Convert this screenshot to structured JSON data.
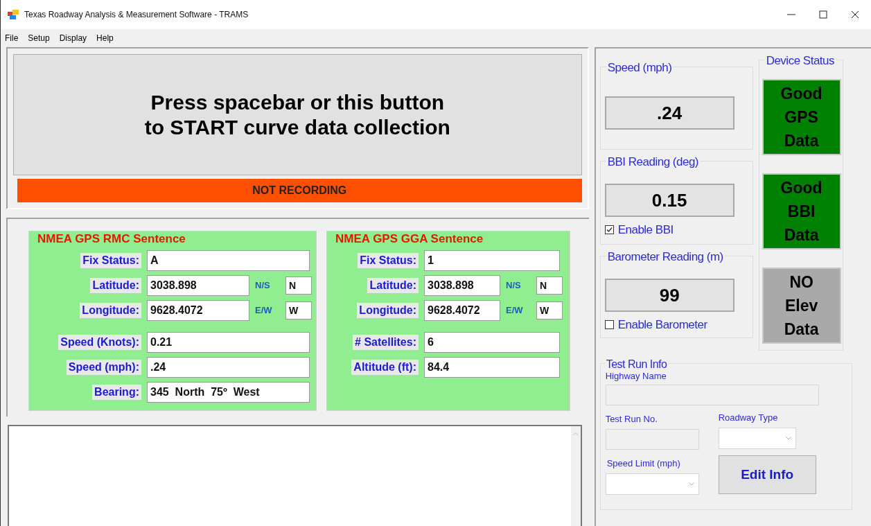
{
  "window": {
    "title": "Texas Roadway Analysis & Measurement Software - TRAMS"
  },
  "menu": [
    "File",
    "Setup",
    "Display",
    "Help"
  ],
  "start_button": {
    "lines": [
      "Press spacebar or this button",
      "to START curve data collection"
    ]
  },
  "recording_status": {
    "text": "NOT RECORDING",
    "recording": false
  },
  "sentences": [
    {
      "title": "NMEA GPS RMC Sentence",
      "fields": [
        {
          "label": "Fix Status:",
          "value": "A"
        },
        {
          "label": "Latitude:",
          "value": "3038.898",
          "suffix_label": "N/S",
          "suffix_value": "N"
        },
        {
          "label": "Longitude:",
          "value": "9628.4072",
          "suffix_label": "E/W",
          "suffix_value": "W"
        },
        {
          "label": "Speed (Knots):",
          "value": "0.21"
        },
        {
          "label": "Speed (mph):",
          "value": ".24"
        },
        {
          "label": "Bearing:",
          "value": "345  North  75º  West"
        }
      ]
    },
    {
      "title": "NMEA GPS GGA Sentence",
      "fields": [
        {
          "label": "Fix Status:",
          "value": "1"
        },
        {
          "label": "Latitude:",
          "value": "3038.898",
          "suffix_label": "N/S",
          "suffix_value": "N"
        },
        {
          "label": "Longitude:",
          "value": "9628.4072",
          "suffix_label": "E/W",
          "suffix_value": "W"
        },
        {
          "label": "# Satellites:",
          "value": "6"
        },
        {
          "label": "Altitude (ft):",
          "value": "84.4"
        }
      ]
    }
  ],
  "readings": [
    {
      "title": "Speed (mph)",
      "value": ".24"
    },
    {
      "title": "BBI Reading (deg)",
      "value": "0.15",
      "checkbox": {
        "label": "Enable BBI",
        "checked": true
      }
    },
    {
      "title": "Barometer Reading (m)",
      "value": "99",
      "checkbox": {
        "label": "Enable Barometer",
        "checked": false
      }
    }
  ],
  "device_status": {
    "title": "Device Status",
    "items": [
      {
        "lines": [
          "Good",
          "GPS",
          "Data"
        ],
        "ok": true
      },
      {
        "lines": [
          "Good",
          "BBI",
          "Data"
        ],
        "ok": true
      },
      {
        "lines": [
          "NO",
          "Elev",
          "Data"
        ],
        "ok": false
      }
    ]
  },
  "test_run": {
    "title": "Test Run Info",
    "highway_label": "Highway Name",
    "run_label": "Test Run No.",
    "roadway_label": "Roadway Type",
    "speed_limit_label": "Speed Limit (mph)",
    "button": "Edit Info"
  }
}
